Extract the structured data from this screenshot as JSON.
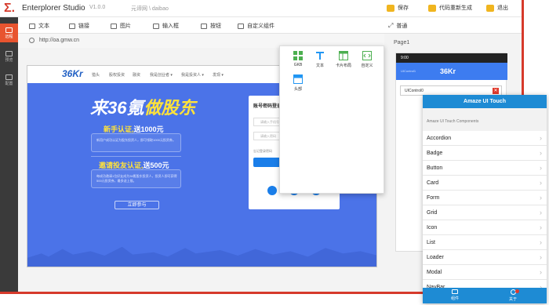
{
  "app": {
    "logo": "Σ.",
    "brand": "Enterplorer Studio",
    "version": "V1.0.0",
    "project": "元谛网 \\ daibao",
    "top_actions": [
      {
        "label": "保存",
        "icon": "save-icon"
      },
      {
        "label": "代码重新生成",
        "icon": "code-icon"
      },
      {
        "label": "退出",
        "icon": "exit-icon"
      }
    ]
  },
  "sidebar": {
    "items": [
      {
        "label": "远程",
        "icon": "edit-icon",
        "active": true
      },
      {
        "label": "预览",
        "icon": "monitor-icon",
        "active": false
      },
      {
        "label": "配置",
        "icon": "config-icon",
        "active": false
      }
    ]
  },
  "toolbar": {
    "items": [
      {
        "label": "文本",
        "icon": "text-icon"
      },
      {
        "label": "链接",
        "icon": "link-icon"
      },
      {
        "label": "图片",
        "icon": "image-icon"
      },
      {
        "label": "输入框",
        "icon": "input-icon"
      },
      {
        "label": "按钮",
        "icon": "button-icon"
      },
      {
        "label": "自定义组件",
        "icon": "component-icon"
      }
    ],
    "right_item": {
      "label": "普通",
      "icon": "expand-icon"
    }
  },
  "urlbar": {
    "url": "http://oa.gmw.cn"
  },
  "site": {
    "logo": "36Kr",
    "nav": [
      "猎头",
      "股权投资",
      "融资",
      "我是创业者 ▾",
      "我是投资人 ▾",
      "发现 ▾"
    ],
    "hero_title_white": "来36氪",
    "hero_title_yellow": "做股东",
    "promo1_head": "新手认证,",
    "promo1_amount": "送1000元",
    "promo1_text": "新用户成功认证为股东投资人，即可领取1000元投资券。",
    "promo2_head": "邀请投友认证,",
    "promo2_amount": "送500元",
    "promo2_text": "每成功邀请1位好友成为36氪股东投资人，投资人即可获得500元投资券，最多送上限。",
    "cta": "立即参与",
    "login_title": "账号密码登录",
    "login_phone": "请输入手机号",
    "login_password": "请输入密码",
    "login_forgot": "忘记登录密码",
    "login_social": "社交网络登录"
  },
  "component_popup": {
    "items": [
      {
        "label": "GKB",
        "icon": "grid-icon",
        "color": "#4caf50"
      },
      {
        "label": "文本",
        "icon": "text-icon",
        "color": "#2196f3"
      },
      {
        "label": "卡片布局",
        "icon": "card-layout-icon",
        "color": "#4caf50"
      },
      {
        "label": "自定义",
        "icon": "custom-code-icon",
        "color": "#4caf50"
      },
      {
        "label": "头部",
        "icon": "header-icon",
        "color": "#2196f3"
      }
    ]
  },
  "page_panel": {
    "label": "Page1",
    "phone_time": "9:00",
    "header_title": "36Kr",
    "header_sub": "UIControl1",
    "uicontrol": "UIControl0"
  },
  "amaze": {
    "title": "Amaze UI Touch",
    "subtitle": "Amaze UI Touch Components",
    "items": [
      "Accordion",
      "Badge",
      "Button",
      "Card",
      "Form",
      "Grid",
      "Icon",
      "List",
      "Loader",
      "Modal",
      "NavBar"
    ],
    "footer": [
      {
        "label": "组件",
        "icon": "list-icon"
      },
      {
        "label": "关于",
        "icon": "info-icon",
        "badge": "5"
      }
    ]
  },
  "colors": {
    "accent": "#d63a2b",
    "canvas_blue": "#4b73e8",
    "amaze_blue": "#1e8bd4",
    "highlight_yellow": "#ffe23a"
  }
}
